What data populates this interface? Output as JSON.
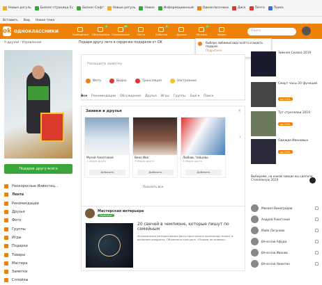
{
  "browser": {
    "bookmarks": [
      "Новые регуль",
      "Бизнес-страница Ес",
      "Бизнес-Софт",
      "Новые регуль",
      "Новое",
      "Информационный",
      "Одноклассники",
      "Диск",
      "Почта",
      "Поиск"
    ],
    "menu": [
      "Вставить",
      "Вид",
      "Новое тема"
    ]
  },
  "header": {
    "brand": "ОДНОКЛАССНИКИ",
    "nav": [
      {
        "label": "Сообщения",
        "badge": "",
        "icon": "mail-icon"
      },
      {
        "label": "Обсуждения",
        "badge": "1",
        "icon": "chat-icon"
      },
      {
        "label": "Оповещения",
        "badge": "10",
        "icon": "bell-icon"
      },
      {
        "label": "Гости",
        "badge": "",
        "icon": "footprints-icon"
      },
      {
        "label": "События",
        "badge": "8",
        "icon": "star-icon"
      },
      {
        "label": "Друзья",
        "badge": "",
        "icon": "friends-icon"
      },
      {
        "label": "Музыка",
        "badge": "1",
        "icon": "music-icon"
      },
      {
        "label": "Видео",
        "badge": "",
        "icon": "video-icon"
      }
    ],
    "search_placeholder": "Поиск"
  },
  "left": {
    "user_line": "0 друзей · Управление",
    "gift_button": "Подарок другу всего",
    "menu": [
      {
        "label": "Низкорослые Инвестиц…",
        "icon": "user-icon"
      },
      {
        "label": "Лента",
        "icon": "feed-icon",
        "active": true
      },
      {
        "label": "Рекомендации",
        "icon": "recommend-icon"
      },
      {
        "label": "Друзья",
        "icon": "friends-icon"
      },
      {
        "label": "Фото",
        "icon": "photo-icon"
      },
      {
        "label": "Группы",
        "icon": "groups-icon"
      },
      {
        "label": "Игры",
        "icon": "games-icon"
      },
      {
        "label": "Подарки",
        "icon": "gift-icon"
      },
      {
        "label": "Товары",
        "icon": "shop-icon"
      },
      {
        "label": "Мастера",
        "icon": "tools-icon"
      },
      {
        "label": "Заметки",
        "icon": "notes-icon"
      },
      {
        "label": "Сплойлы",
        "icon": "bulb-icon"
      }
    ]
  },
  "center": {
    "gift_row": "Подари другу лето в сердечке подарком от OK",
    "tooltip": {
      "text": "Выбери любимый вид полёта и видеть подарок",
      "link": "Подробнее"
    },
    "post_placeholder": "Напишите заметку",
    "actions": [
      {
        "label": "Фото",
        "color": "#ee8208"
      },
      {
        "label": "Видео",
        "color": "#e0342f"
      },
      {
        "label": "Трансляция",
        "color": "#e0342f"
      },
      {
        "label": "Настроение",
        "color": "#f1c232"
      }
    ],
    "tabs": [
      "Все",
      "Рекомендации",
      "Обсуждения",
      "Друзья",
      "Игры",
      "Группы",
      "Ещё ▾",
      "Поиск"
    ],
    "friends_block": {
      "title": "Заявки в друзья",
      "close": "×",
      "cards": [
        {
          "name": "Музей Ахматовой",
          "sub": "2 общих друга",
          "btn": "Добавить"
        },
        {
          "name": "Вика Ива",
          "sub": "2 общих друга",
          "btn": "Добавить"
        },
        {
          "name": "Любовь Чайцева",
          "sub": "2 общих друга",
          "btn": "Добавить"
        }
      ],
      "show_all": "Показать все",
      "next": "›"
    },
    "feed": {
      "author": "Мастерская интерьера",
      "badge": "Полезное",
      "title": "20 свечей в чемпионе, которые пишут по семейным",
      "text": "Музыкальная интерактивная фото-приставка в хранилище пишет и вечерние квадраты. Объявлена конкурса. «Пишем по-новому»."
    }
  },
  "right": {
    "blocks": [
      {
        "title": "Зимняя Сказка 2019",
        "price": "",
        "img": "#1a1a2e"
      },
      {
        "title": "Смарт часы 20 функций",
        "price": "до 29%",
        "img": "#444"
      },
      {
        "title": "Тут стрелялки 2019",
        "price": "до 29%",
        "img": "#6a7a5a"
      },
      {
        "title": "Одежда Ивановых",
        "price": "до 29%",
        "img": "#2a2a3a"
      }
    ],
    "subscribe_text": "Выбираем, на каком заводе вы сделали Стеклянную 2019",
    "people": [
      "Михаил Виноградов",
      "Андрей Ракитский",
      "Майя Лагунова",
      "Вячеслав Афуда",
      "Вячеслав Иванов",
      "Вячеслав Никитин"
    ]
  }
}
